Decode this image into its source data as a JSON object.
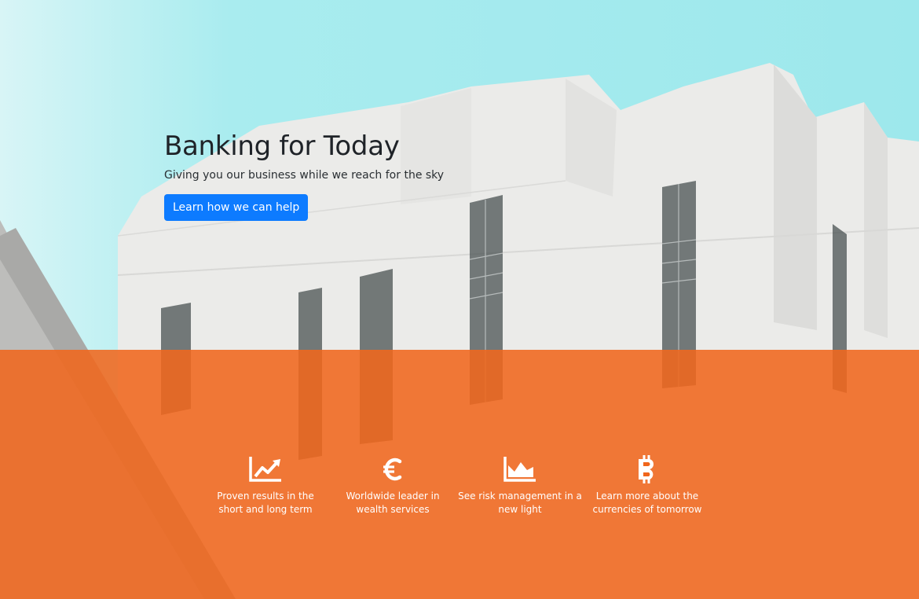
{
  "hero": {
    "title": "Banking for Today",
    "subtitle": "Giving you our business while we reach for the sky",
    "cta_label": "Learn how we can help"
  },
  "features": [
    {
      "icon": "chart-line-icon",
      "text": "Proven results in the short and long term"
    },
    {
      "icon": "euro-icon",
      "text": "Worldwide leader in wealth services"
    },
    {
      "icon": "chart-area-icon",
      "text": "See risk management in a new light"
    },
    {
      "icon": "bitcoin-icon",
      "text": "Learn more about the currencies of tomorrow"
    }
  ],
  "colors": {
    "sky": "#a7ecef",
    "building": "#ececea",
    "overlay": "#f0661c",
    "button": "#0d7bff",
    "title_text": "#1f2328"
  }
}
